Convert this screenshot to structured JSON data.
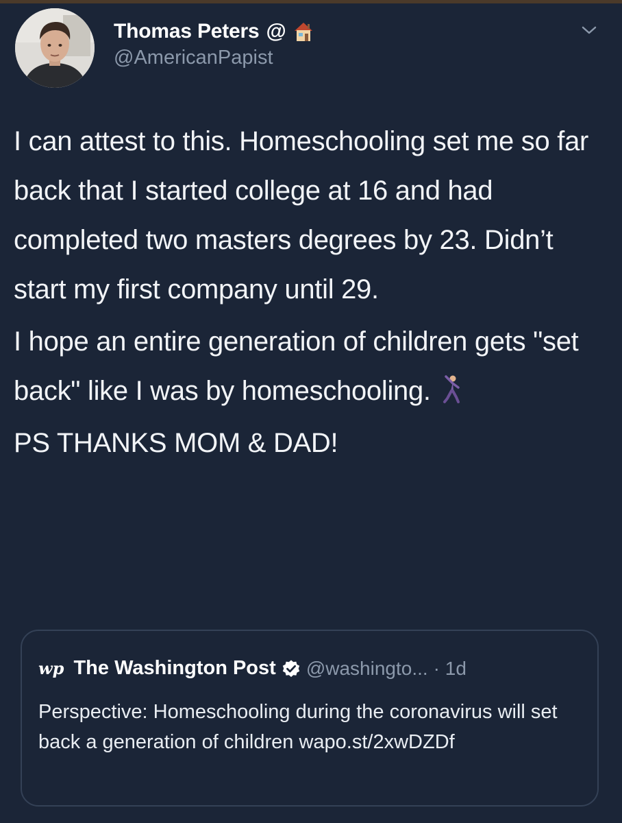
{
  "author": {
    "display_name": "Thomas Peters",
    "name_suffix": "@",
    "handle": "@AmericanPapist"
  },
  "tweet": {
    "paragraphs": [
      "I can attest to this. Homeschooling set me so far back that I started college at 16 and had completed two masters degrees by 23. Didn’t start my first company until 29.",
      "I hope an entire generation of children gets \"set back\" like I was by homeschooling.",
      "PS THANKS MOM & DAD!"
    ]
  },
  "quoted_tweet": {
    "logo": "wp",
    "name": "The Washington Post",
    "handle": "@washingto...",
    "time": "· 1d",
    "text": "Perspective: Homeschooling during the coronavirus will set back a generation of children wapo.st/2xwDZDf"
  },
  "icons": {
    "house": "house-emoji-icon",
    "dancer": "man-dancing-emoji-icon",
    "verified": "verified-badge-icon",
    "menu": "chevron-down-icon"
  },
  "colors": {
    "background": "#1b2537",
    "secondary_text": "#8c99ab",
    "card_border": "#344156"
  }
}
